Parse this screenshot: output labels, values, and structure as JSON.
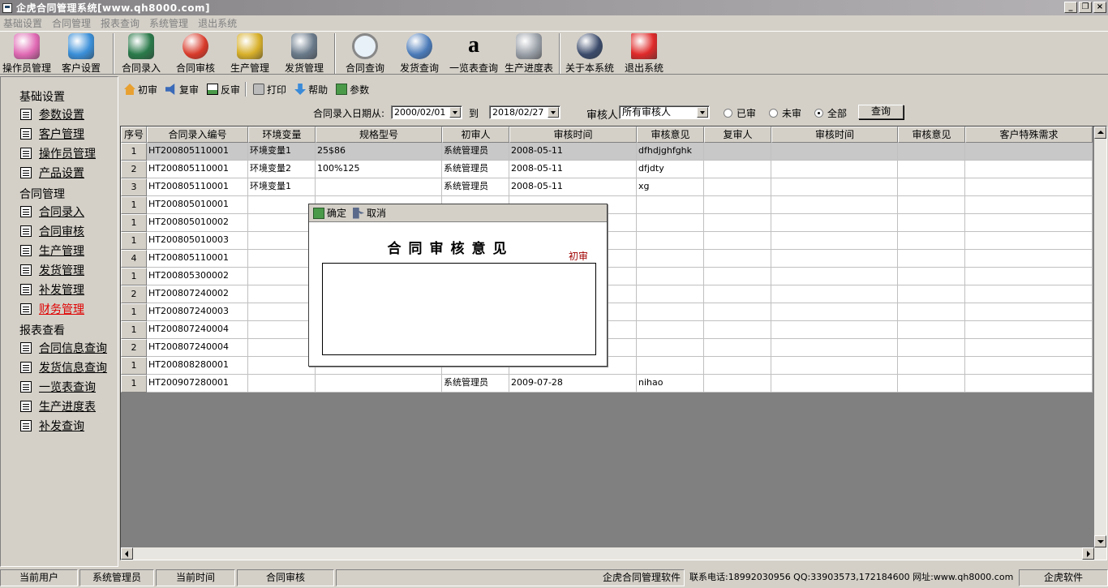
{
  "window": {
    "title": "企虎合同管理系统[www.qh8000.com]",
    "buttons": [
      "_",
      "❐",
      "×"
    ]
  },
  "menu": [
    "基础设置",
    "合同管理",
    "报表查询",
    "系统管理",
    "退出系统"
  ],
  "toolbar": [
    {
      "label": "操作员管理",
      "icon": "operator-icon",
      "color": "#e06ab4"
    },
    {
      "label": "客户设置",
      "icon": "customer-icon",
      "color": "#3a8fd8"
    },
    {
      "label": "合同录入",
      "icon": "contract-entry-icon",
      "color": "#2a7a4a"
    },
    {
      "label": "合同审核",
      "icon": "contract-audit-icon",
      "color": "#d83a2a"
    },
    {
      "label": "生产管理",
      "icon": "production-icon",
      "color": "#d8b02a"
    },
    {
      "label": "发货管理",
      "icon": "shipping-icon",
      "color": "#6a7a8a"
    },
    {
      "label": "合同查询",
      "icon": "search-icon",
      "color": "#8a8a8a"
    },
    {
      "label": "发货查询",
      "icon": "database-icon",
      "color": "#4a7ab8"
    },
    {
      "label": "一览表查询",
      "icon": "amazon-icon",
      "color": "#ffffff"
    },
    {
      "label": "生产进度表",
      "icon": "schedule-icon",
      "color": "#9aa0a8"
    },
    {
      "label": "关于本系统",
      "icon": "about-icon",
      "color": "#3a4a6a"
    },
    {
      "label": "退出系统",
      "icon": "exit-icon",
      "color": "#e02a2a"
    }
  ],
  "sidebar": {
    "groups": [
      {
        "title": "基础设置",
        "items": [
          "参数设置",
          "客户管理",
          "操作员管理",
          "产品设置"
        ]
      },
      {
        "title": "合同管理",
        "items": [
          "合同录入",
          "合同审核",
          "生产管理",
          "发货管理",
          "补发管理",
          "财务管理"
        ]
      },
      {
        "title": "报表查看",
        "items": [
          "合同信息查询",
          "发货信息查询",
          "一览表查询",
          "生产进度表",
          "补发查询"
        ]
      }
    ],
    "active_item": "财务管理"
  },
  "subtools": {
    "first": "初审",
    "second": "复审",
    "reverse": "反审",
    "print": "打印",
    "help": "帮助",
    "params": "参数"
  },
  "filters": {
    "date_label": "合同录入日期从:",
    "date_from": "2000/02/01",
    "to_label": "到",
    "date_to": "2018/02/27",
    "auditor_label": "审核人",
    "auditor_value": "所有审核人",
    "radio_done": "已审",
    "radio_pending": "未审",
    "radio_all": "全部",
    "selected_radio": "全部",
    "query_button": "查询"
  },
  "grid": {
    "columns": [
      "序号",
      "合同录入编号",
      "环境变量",
      "规格型号",
      "初审人",
      "审核时间",
      "审核意见",
      "复审人",
      "审核时间",
      "审核意见",
      "客户特殊需求"
    ],
    "rows": [
      [
        "1",
        "HT200805110001",
        "环境变量1",
        "25$86",
        "系统管理员",
        "2008-05-11",
        "dfhdjghfghk",
        "",
        "",
        "",
        ""
      ],
      [
        "2",
        "HT200805110001",
        "环境变量2",
        "100%125",
        "系统管理员",
        "2008-05-11",
        "dfjdty",
        "",
        "",
        "",
        ""
      ],
      [
        "3",
        "HT200805110001",
        "环境变量1",
        "",
        "系统管理员",
        "2008-05-11",
        "xg",
        "",
        "",
        "",
        ""
      ],
      [
        "1",
        "HT200805010001",
        "",
        "",
        "",
        "",
        "",
        "",
        "",
        "",
        ""
      ],
      [
        "1",
        "HT200805010002",
        "",
        "",
        "",
        "",
        "",
        "",
        "",
        "",
        ""
      ],
      [
        "1",
        "HT200805010003",
        "",
        "",
        "",
        "",
        "",
        "",
        "",
        "",
        ""
      ],
      [
        "4",
        "HT200805110001",
        "",
        "",
        "",
        "",
        "",
        "",
        "",
        "",
        ""
      ],
      [
        "1",
        "HT200805300002",
        "",
        "",
        "",
        "",
        "",
        "",
        "",
        "",
        ""
      ],
      [
        "2",
        "HT200807240002",
        "",
        "",
        "",
        "",
        "",
        "",
        "",
        "",
        ""
      ],
      [
        "1",
        "HT200807240003",
        "",
        "",
        "",
        "",
        "",
        "",
        "",
        "",
        ""
      ],
      [
        "1",
        "HT200807240004",
        "",
        "",
        "",
        "",
        "",
        "",
        "",
        "",
        ""
      ],
      [
        "2",
        "HT200807240004",
        "",
        "",
        "",
        "",
        "",
        "",
        "",
        "",
        ""
      ],
      [
        "1",
        "HT200808280001",
        "",
        "",
        "",
        "",
        "",
        "",
        "",
        "",
        ""
      ],
      [
        "1",
        "HT200907280001",
        "",
        "",
        "系统管理员",
        "2009-07-28",
        "nihao",
        "",
        "",
        "",
        ""
      ]
    ]
  },
  "dialog": {
    "ok": "确定",
    "cancel": "取消",
    "title": "合同审核意见",
    "stage": "初审",
    "text": ""
  },
  "status": [
    "当前用户",
    "系统管理员",
    "当前时间",
    "合同审核",
    "企虎合同管理软件",
    "联系电话:18992030956 QQ:33903573,172184600 网址:www.qh8000.com",
    "企虎软件"
  ]
}
